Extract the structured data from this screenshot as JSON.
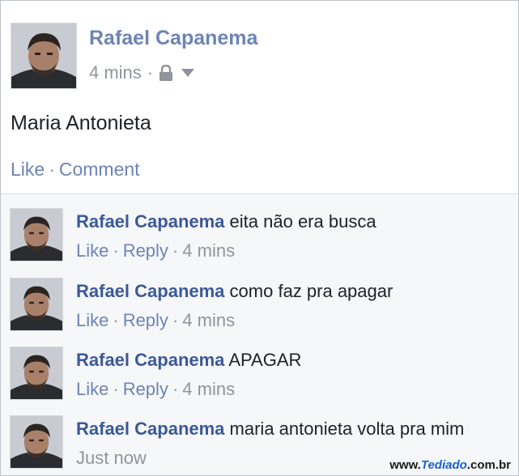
{
  "post": {
    "author": "Rafael Capanema",
    "time": "4 mins",
    "dot": "·",
    "text": "Maria Antonieta",
    "actions": {
      "like": "Like",
      "sep": "·",
      "comment": "Comment"
    },
    "icons": {
      "privacy": "lock-icon",
      "menu": "chevron-down-icon"
    }
  },
  "comments": [
    {
      "author": "Rafael Capanema",
      "text": "eita não era busca",
      "like": "Like",
      "reply": "Reply",
      "time": "4 mins"
    },
    {
      "author": "Rafael Capanema",
      "text": "como faz pra apagar",
      "like": "Like",
      "reply": "Reply",
      "time": "4 mins"
    },
    {
      "author": "Rafael Capanema",
      "text": "APAGAR",
      "like": "Like",
      "reply": "Reply",
      "time": "4 mins"
    },
    {
      "author": "Rafael Capanema",
      "text": "maria antonieta volta pra mim",
      "time": "Just now"
    }
  ],
  "separator": "·",
  "watermark": {
    "prefix": "www.",
    "brand": "Tediado",
    "suffix": ".com.br"
  },
  "colors": {
    "link": "#3b5998",
    "action": "#6d84b4",
    "meta": "#90949c",
    "comment_bg": "#f6f7f9"
  }
}
